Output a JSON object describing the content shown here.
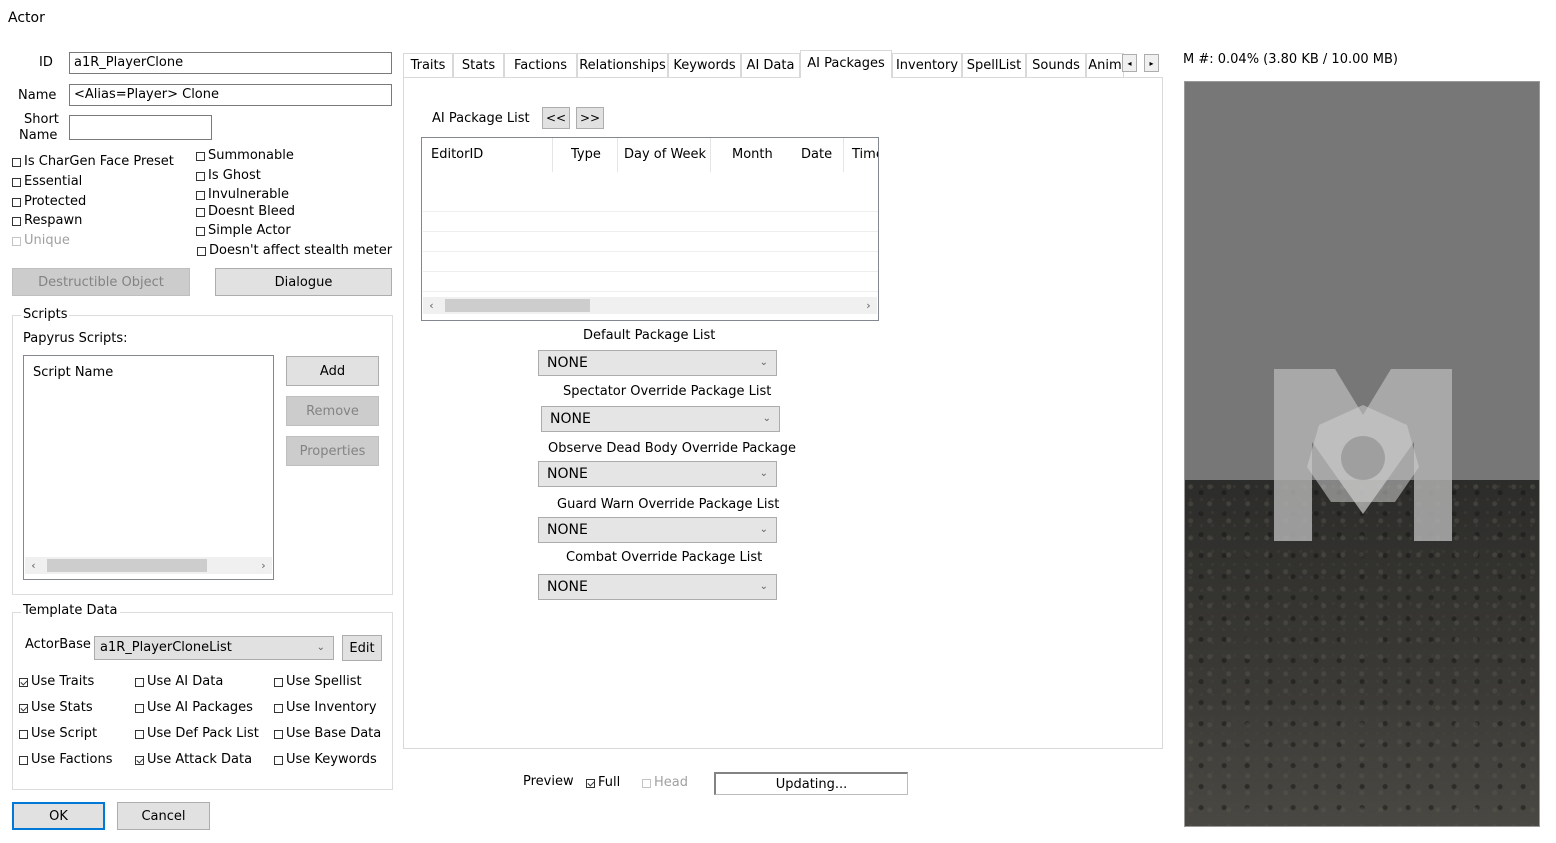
{
  "window": {
    "title": "Actor"
  },
  "identity": {
    "id_label": "ID",
    "id_value": "a1R_PlayerClone",
    "name_label": "Name",
    "name_value": "<Alias=Player> Clone",
    "short_name_label_1": "Short",
    "short_name_label_2": "Name",
    "short_name_value": ""
  },
  "flags_left": [
    {
      "label": "Is CharGen Face Preset",
      "checked": false,
      "enabled": true
    },
    {
      "label": "Essential",
      "checked": false,
      "enabled": true
    },
    {
      "label": "Protected",
      "checked": false,
      "enabled": true
    },
    {
      "label": "Respawn",
      "checked": false,
      "enabled": true
    },
    {
      "label": "Unique",
      "checked": false,
      "enabled": false
    }
  ],
  "flags_right": [
    {
      "label": "Summonable",
      "checked": false
    },
    {
      "label": "Is Ghost",
      "checked": false
    },
    {
      "label": "Invulnerable",
      "checked": false
    },
    {
      "label": "Doesnt Bleed",
      "checked": false
    },
    {
      "label": "Simple Actor",
      "checked": false
    },
    {
      "label": "Doesn't affect stealth meter",
      "checked": false
    }
  ],
  "buttons": {
    "destructible": "Destructible Object",
    "dialogue": "Dialogue",
    "add": "Add",
    "remove": "Remove",
    "properties": "Properties",
    "edit": "Edit",
    "ok": "OK",
    "cancel": "Cancel"
  },
  "scripts": {
    "group_title": "Scripts",
    "papyrus_label": "Papyrus Scripts:",
    "column_header": "Script Name"
  },
  "template": {
    "group_title": "Template Data",
    "actorbase_label": "ActorBase",
    "actorbase_value": "a1R_PlayerCloneList",
    "checks": [
      {
        "label": "Use Traits",
        "checked": true
      },
      {
        "label": "Use AI Data",
        "checked": false
      },
      {
        "label": "Use Spellist",
        "checked": false
      },
      {
        "label": "Use Stats",
        "checked": true
      },
      {
        "label": "Use AI Packages",
        "checked": false
      },
      {
        "label": "Use Inventory",
        "checked": false
      },
      {
        "label": "Use Script",
        "checked": false
      },
      {
        "label": "Use Def Pack List",
        "checked": false
      },
      {
        "label": "Use Base Data",
        "checked": false
      },
      {
        "label": "Use Factions",
        "checked": false
      },
      {
        "label": "Use Attack Data",
        "checked": true
      },
      {
        "label": "Use Keywords",
        "checked": false
      }
    ]
  },
  "tabs": [
    {
      "label": "Traits"
    },
    {
      "label": "Stats"
    },
    {
      "label": "Factions"
    },
    {
      "label": "Relationships"
    },
    {
      "label": "Keywords"
    },
    {
      "label": "AI Data"
    },
    {
      "label": "AI Packages",
      "active": true
    },
    {
      "label": "Inventory"
    },
    {
      "label": "SpellList"
    },
    {
      "label": "Sounds"
    },
    {
      "label": "Anim"
    }
  ],
  "ai_packages": {
    "list_label": "AI Package List",
    "prev_label": "<<",
    "next_label": ">>",
    "columns": [
      "EditorID",
      "Type",
      "Day of Week",
      "Month",
      "Date",
      "Time"
    ],
    "lists": [
      {
        "label": "Default Package List",
        "value": "NONE"
      },
      {
        "label": "Spectator Override Package List",
        "value": "NONE"
      },
      {
        "label": "Observe Dead Body Override Package",
        "value": "NONE"
      },
      {
        "label": "Guard Warn Override Package List",
        "value": "NONE"
      },
      {
        "label": "Combat Override Package List",
        "value": "NONE"
      }
    ]
  },
  "preview": {
    "label": "Preview",
    "full_label": "Full",
    "full_checked": true,
    "head_label": "Head",
    "head_checked": false,
    "status": "Updating...",
    "memory": "M #: 0.04% (3.80 KB / 10.00 MB)"
  },
  "icons": {
    "scroll_left": "‹",
    "scroll_right": "›",
    "tab_left": "◂",
    "tab_right": "▸",
    "dropdown": "⌄"
  }
}
